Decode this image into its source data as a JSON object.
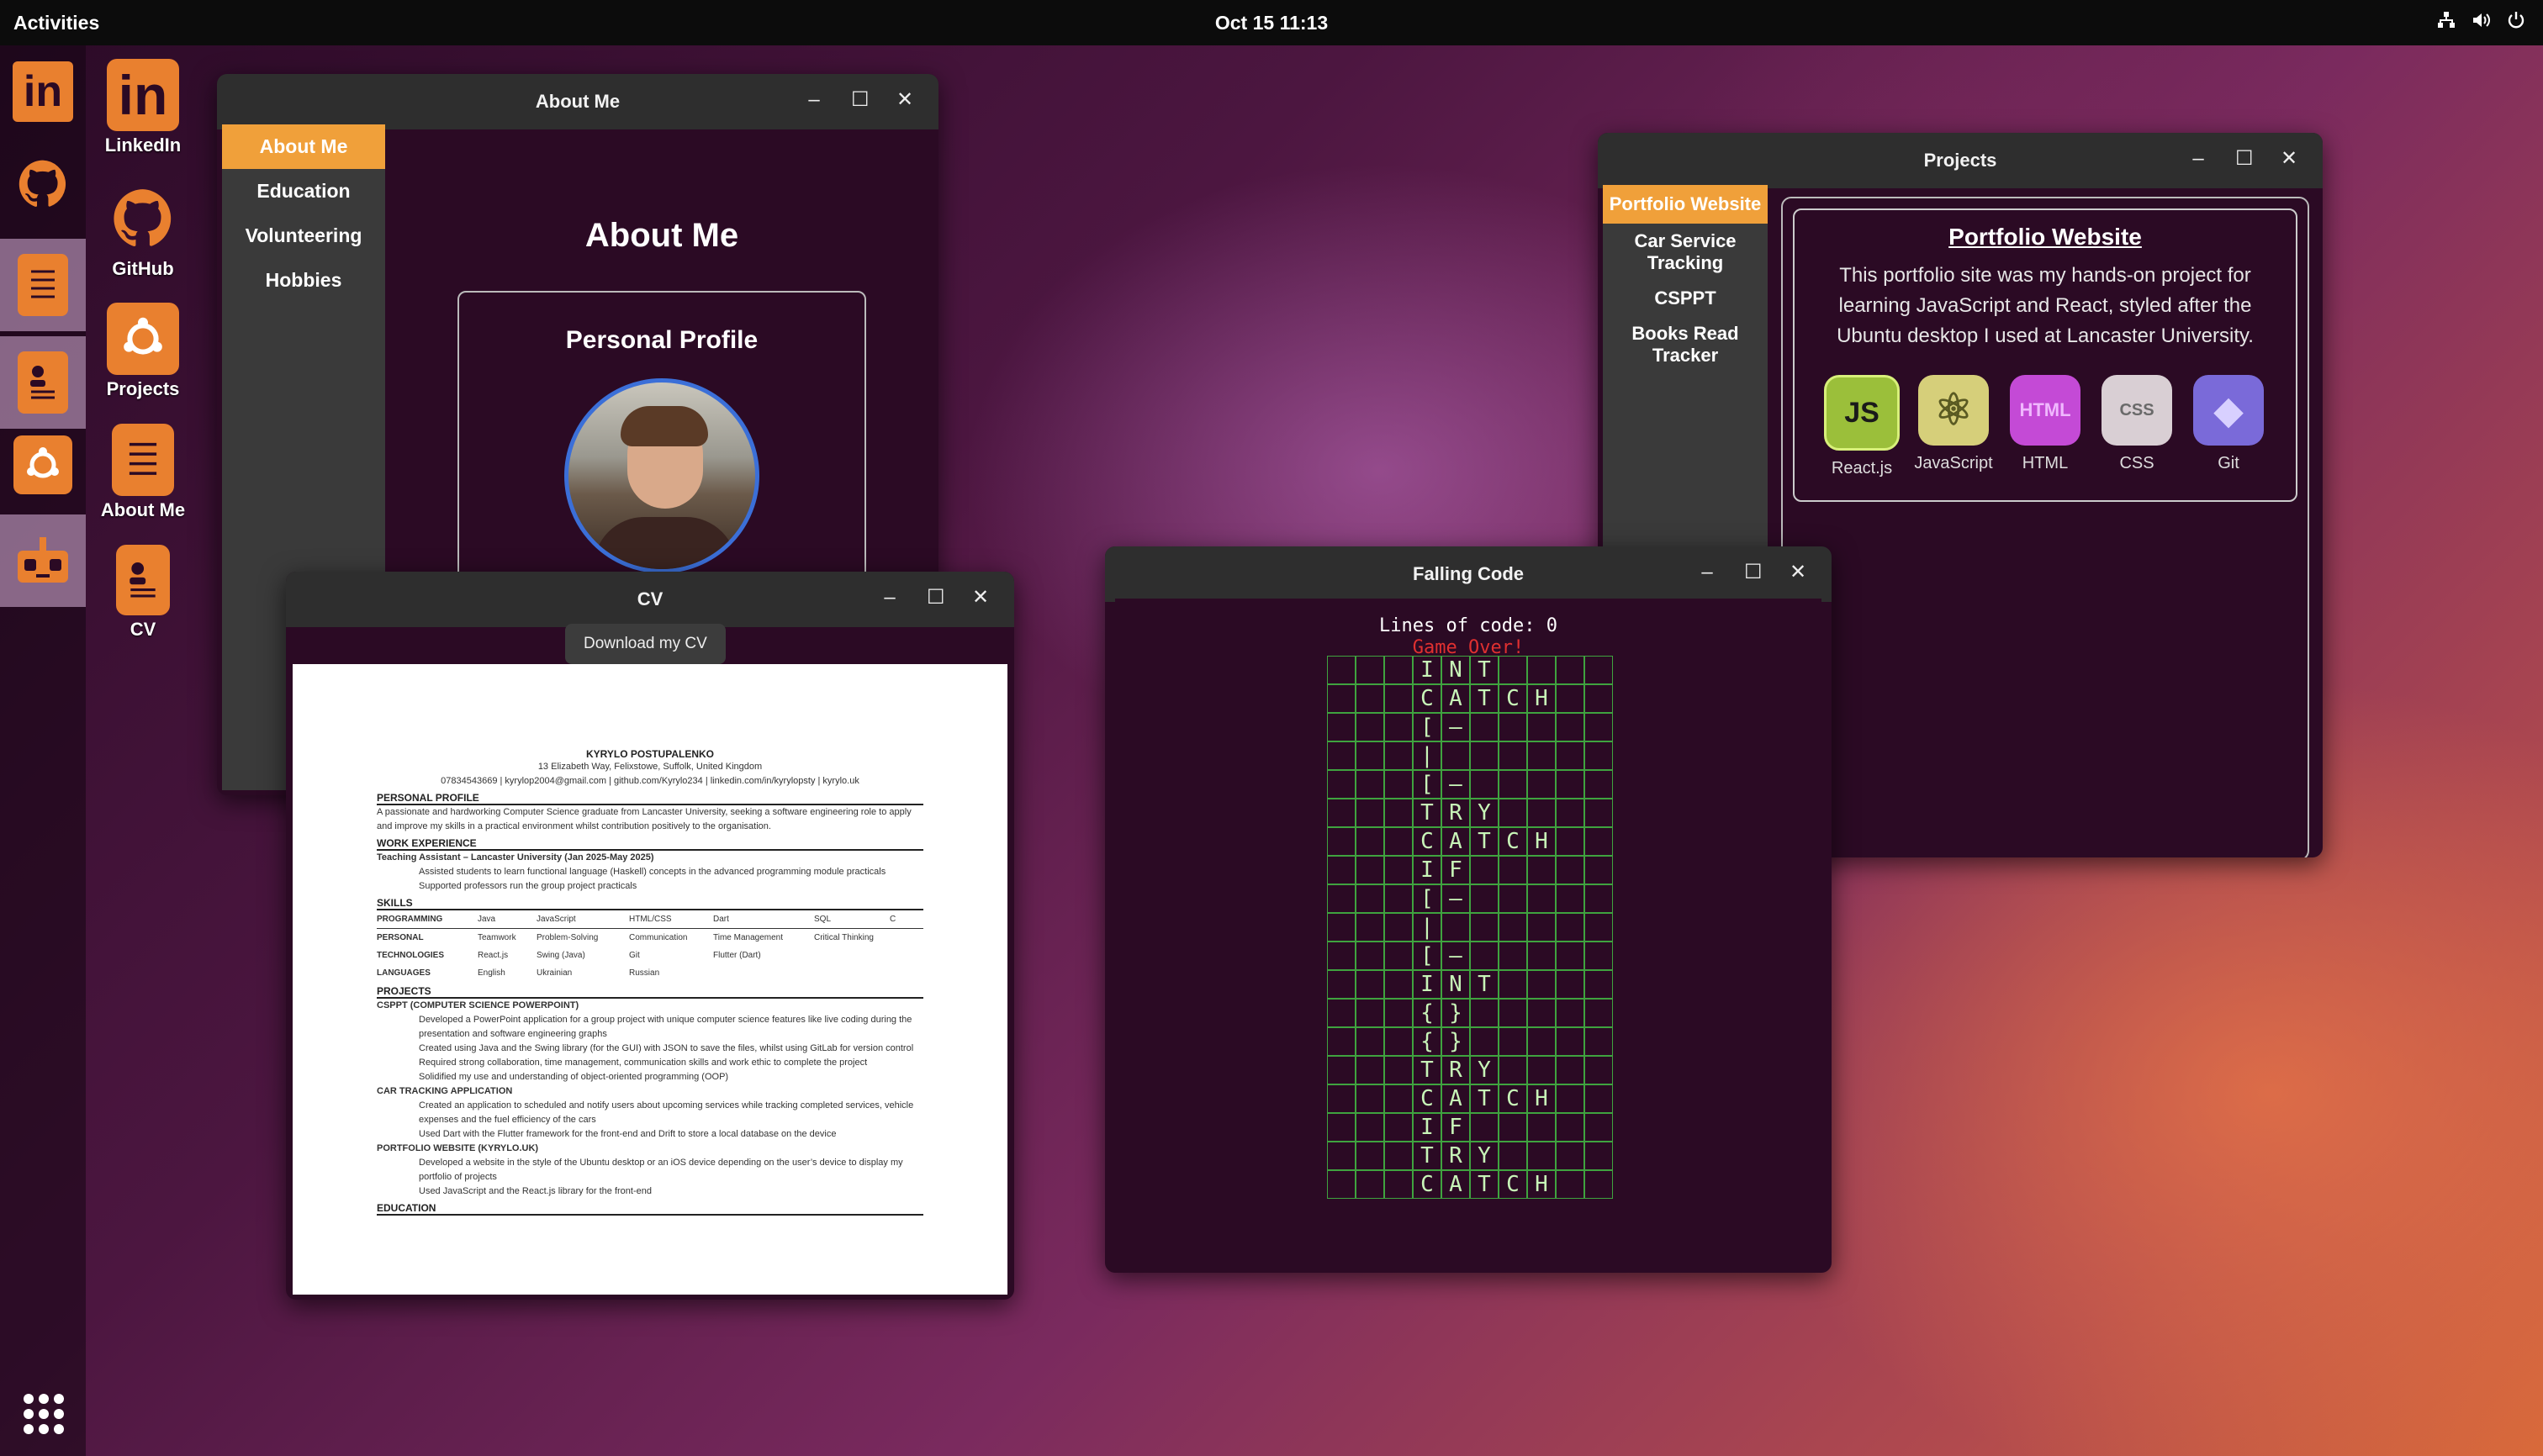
{
  "topbar": {
    "activities": "Activities",
    "clock": "Oct 15  11:13"
  },
  "dock": {
    "items": [
      "linkedin-icon",
      "github-icon",
      "about-me-icon",
      "cv-icon",
      "projects-icon",
      "game-icon"
    ]
  },
  "desktop": {
    "icons": [
      {
        "label": "LinkedIn",
        "glyph": "in"
      },
      {
        "label": "GitHub",
        "glyph": ""
      },
      {
        "label": "Projects",
        "glyph": ""
      },
      {
        "label": "About Me",
        "glyph": ""
      },
      {
        "label": "CV",
        "glyph": ""
      }
    ]
  },
  "about_window": {
    "title": "About Me",
    "nav": [
      "About Me",
      "Education",
      "Volunteering",
      "Hobbies"
    ],
    "heading": "About Me",
    "card_title": "Personal Profile"
  },
  "cv_window": {
    "title": "CV",
    "download": "Download my CV",
    "name": "KYRYLO POSTUPALENKO",
    "address": "13 Elizabeth Way, Felixstowe, Suffolk, United Kingdom",
    "contact": "07834543669 | kyrylop2004@gmail.com | github.com/Kyrylo234 | linkedin.com/in/kyrylopsty | kyrylo.uk",
    "sections": {
      "profile_head": "PERSONAL PROFILE",
      "profile_text": "A passionate and hardworking Computer Science graduate from Lancaster University, seeking a software engineering role to apply and improve my skills in a practical environment whilst contribution positively to the organisation.",
      "work_head": "WORK EXPERIENCE",
      "work_title": "Teaching Assistant – Lancaster University (Jan 2025-May 2025)",
      "work_b1": "Assisted students to learn functional language (Haskell) concepts in the advanced programming module practicals",
      "work_b2": "Supported professors run the group project practicals",
      "skills_head": "SKILLS",
      "skills_rows": [
        [
          "PROGRAMMING",
          "Java",
          "JavaScript",
          "HTML/CSS",
          "Dart",
          "SQL",
          "C"
        ],
        [
          "PERSONAL",
          "Teamwork",
          "Problem-Solving",
          "Communication",
          "Time Management",
          "Critical Thinking",
          ""
        ],
        [
          "TECHNOLOGIES",
          "React.js",
          "Swing (Java)",
          "Git",
          "Flutter (Dart)",
          "",
          ""
        ],
        [
          "LANGUAGES",
          "English",
          "Ukrainian",
          "Russian",
          "",
          "",
          ""
        ]
      ],
      "projects_head": "PROJECTS",
      "p1_title": "CSPPT (COMPUTER SCIENCE POWERPOINT)",
      "p1_b1": "Developed a PowerPoint application for a group project with unique computer science features like live coding during the presentation and software engineering graphs",
      "p1_b2": "Created using Java and the Swing library (for the GUI) with JSON to save the files, whilst using GitLab for version control",
      "p1_b3": "Required strong collaboration, time management, communication skills and work ethic to complete the project",
      "p1_b4": "Solidified my use and understanding of object-oriented programming (OOP)",
      "p2_title": "CAR TRACKING APPLICATION",
      "p2_b1": "Created an application to scheduled and notify users about upcoming services while tracking completed services, vehicle expenses and the fuel efficiency of the cars",
      "p2_b2": "Used Dart with the Flutter framework for the front-end and Drift to store a local database on the device",
      "p3_title": "PORTFOLIO WEBSITE (KYRYLO.UK)",
      "p3_b1": "Developed a website in the style of the Ubuntu desktop or an iOS device depending on the user’s device to display my portfolio of projects",
      "p3_b2": "Used JavaScript and the React.js library for the front-end",
      "edu_head": "EDUCATION"
    }
  },
  "game_window": {
    "title": "Falling Code",
    "score_label": "Lines of code: 0",
    "game_over": "Game Over!",
    "rows": [
      "INT",
      "CATCH",
      "[–",
      "|",
      "[–",
      "TRY",
      "CATCH",
      "IF",
      "[–",
      "|",
      "[–",
      "INT",
      "{}",
      "{}",
      "TRY",
      "CATCH",
      "IF",
      "TRY",
      "CATCH"
    ]
  },
  "projects_window": {
    "title": "Projects",
    "nav": [
      "Portfolio Website",
      "Car Service Tracking",
      "CSPPT",
      "Books Read Tracker"
    ],
    "card_title": "Portfolio Website",
    "card_text": "This portfolio site was my hands-on project for learning JavaScript and React, styled after the Ubuntu desktop I used at Lancaster University.",
    "tech": [
      {
        "label": "React.js",
        "glyph": "JS",
        "bg": "#9bbf3a",
        "fg": "#1a1a1a"
      },
      {
        "label": "JavaScript",
        "glyph": "⚛",
        "bg": "#d6cf7a",
        "fg": "#5a5a22"
      },
      {
        "label": "HTML",
        "glyph": "HTML",
        "bg": "#c44ad6",
        "fg": "#f0b8ff"
      },
      {
        "label": "CSS",
        "glyph": "CSS",
        "bg": "#d9cfd4",
        "fg": "#6a6a6a"
      },
      {
        "label": "Git",
        "glyph": "◆",
        "bg": "#7a6ad9",
        "fg": "#d8d0ff"
      }
    ]
  }
}
